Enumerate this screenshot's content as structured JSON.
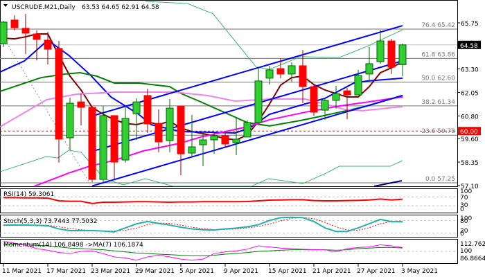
{
  "header": {
    "symbol": "USCRUDE.M21,Daily",
    "ohlc": "63.53 64.65 62.91 64.58"
  },
  "colors": {
    "bull": "#32CD32",
    "bull_edge": "#006400",
    "bear": "#FF0000",
    "bear_edge": "#8B0000",
    "channel": "#0000FF",
    "ma_fast": "#800000",
    "ma_blue": "#0000FF",
    "ma_green": "#008000",
    "ma_violet": "#EE82EE",
    "ma_magenta": "#FF00FF",
    "bands": "#3CB371"
  },
  "price_axis": {
    "ticks": [
      "65.75",
      "63.30",
      "62.05",
      "60.80",
      "59.60",
      "58.35",
      "57.10"
    ],
    "last_price": "64.58",
    "alert_price": "60.00"
  },
  "fib_levels": [
    {
      "label": "76.4 65.42",
      "price": 65.42
    },
    {
      "label": "61.8 63.86",
      "price": 63.86
    },
    {
      "label": "50.0 62.60",
      "price": 62.6
    },
    {
      "label": "38.2 61.34",
      "price": 61.34
    },
    {
      "label": "23.6 59.78",
      "price": 59.78
    },
    {
      "label": "0.0 57.25",
      "price": 57.25
    }
  ],
  "chart_data": {
    "type": "candlestick",
    "candles": [
      [
        64.65,
        65.86,
        64.46,
        65.79
      ],
      [
        65.9,
        66.15,
        65.35,
        65.49
      ],
      [
        65.46,
        66.23,
        64.09,
        65.2
      ],
      [
        65.16,
        65.35,
        63.76,
        64.87
      ],
      [
        64.83,
        65.27,
        63.54,
        64.35
      ],
      [
        64.39,
        64.79,
        58.32,
        59.57
      ],
      [
        59.64,
        61.78,
        58.98,
        61.48
      ],
      [
        61.55,
        62.0,
        60.3,
        61.26
      ],
      [
        61.26,
        61.33,
        57.29,
        57.43
      ],
      [
        57.43,
        61.33,
        57.29,
        60.82
      ],
      [
        60.82,
        60.82,
        57.47,
        58.35
      ],
      [
        58.46,
        61.3,
        58.32,
        60.67
      ],
      [
        60.93,
        61.74,
        59.53,
        61.55
      ],
      [
        61.89,
        62.25,
        59.9,
        60.38
      ],
      [
        60.41,
        61.15,
        58.87,
        59.42
      ],
      [
        59.49,
        61.7,
        58.87,
        61.22
      ],
      [
        61.33,
        61.33,
        57.65,
        58.79
      ],
      [
        58.83,
        60.86,
        58.57,
        59.16
      ],
      [
        59.27,
        59.97,
        58.13,
        59.53
      ],
      [
        59.53,
        59.97,
        58.79,
        59.75
      ],
      [
        59.75,
        59.97,
        59.13,
        59.31
      ],
      [
        59.38,
        60.75,
        58.72,
        59.57
      ],
      [
        59.68,
        60.56,
        59.68,
        60.45
      ],
      [
        60.45,
        63.36,
        60.45,
        62.66
      ],
      [
        62.81,
        63.47,
        62.47,
        63.25
      ],
      [
        63.32,
        63.87,
        62.81,
        63.03
      ],
      [
        63.03,
        63.65,
        62.59,
        63.47
      ],
      [
        63.47,
        64.31,
        61.48,
        62.36
      ],
      [
        62.36,
        62.47,
        60.82,
        61.0
      ],
      [
        61.11,
        61.78,
        60.6,
        61.63
      ],
      [
        61.63,
        62.4,
        61.19,
        61.99
      ],
      [
        62.14,
        62.29,
        60.63,
        61.92
      ],
      [
        61.92,
        63.25,
        61.92,
        62.95
      ],
      [
        63.03,
        64.46,
        62.59,
        63.58
      ],
      [
        63.69,
        65.38,
        63.58,
        64.79
      ],
      [
        64.79,
        64.9,
        63.03,
        63.39
      ],
      [
        63.53,
        64.65,
        62.91,
        64.58
      ]
    ],
    "x_labels": [
      {
        "i": 0,
        "label": "11 Mar 2021"
      },
      {
        "i": 4,
        "label": "17 Mar 2021"
      },
      {
        "i": 8,
        "label": "23 Mar 2021"
      },
      {
        "i": 12,
        "label": "29 Mar 2021"
      },
      {
        "i": 16,
        "label": "5 Apr 2021"
      },
      {
        "i": 20,
        "label": "9 Apr 2021"
      },
      {
        "i": 24,
        "label": "15 Apr 2021"
      },
      {
        "i": 28,
        "label": "21 Apr 2021"
      },
      {
        "i": 32,
        "label": "27 Apr 2021"
      },
      {
        "i": 36,
        "label": "3 May 2021"
      }
    ],
    "ylim": [
      57.1,
      65.75
    ],
    "channel": [
      {
        "from": [
          9,
          60.8
        ],
        "to": [
          37,
          65.6
        ]
      },
      {
        "from": [
          9,
          58.92
        ],
        "to": [
          37,
          63.73
        ]
      },
      {
        "from": [
          9,
          57.08
        ],
        "to": [
          37,
          61.89
        ]
      }
    ],
    "moving_averages": [
      {
        "name": "ma_fast",
        "points": [
          [
            1,
            64.94
          ],
          [
            2,
            64.9
          ],
          [
            3,
            65.01
          ],
          [
            4,
            65.16
          ],
          [
            5,
            65.16
          ],
          [
            6,
            64.02
          ],
          [
            7,
            62.92
          ],
          [
            8,
            62.18
          ],
          [
            9,
            61.26
          ],
          [
            10,
            60.89
          ],
          [
            11,
            60.6
          ],
          [
            12,
            60.41
          ],
          [
            13,
            60.34
          ],
          [
            14,
            60.49
          ],
          [
            15,
            60.34
          ],
          [
            16,
            60.52
          ],
          [
            17,
            60.16
          ],
          [
            18,
            59.97
          ],
          [
            19,
            59.86
          ],
          [
            20,
            59.75
          ],
          [
            21,
            59.6
          ],
          [
            22,
            59.53
          ],
          [
            23,
            59.79
          ],
          [
            24,
            60.52
          ],
          [
            25,
            61.44
          ],
          [
            26,
            62.44
          ],
          [
            27,
            62.84
          ],
          [
            28,
            62.92
          ],
          [
            29,
            62.47
          ],
          [
            30,
            62.18
          ],
          [
            31,
            61.99
          ],
          [
            32,
            61.81
          ],
          [
            33,
            61.81
          ],
          [
            34,
            62.36
          ],
          [
            35,
            63.1
          ],
          [
            36,
            63.36
          ],
          [
            37,
            63.69
          ]
        ]
      },
      {
        "name": "ma_blue",
        "points": [
          [
            0.7,
            63.14
          ],
          [
            2.9,
            63.73
          ],
          [
            5,
            64.83
          ],
          [
            6.9,
            64.02
          ],
          [
            8.8,
            63.0
          ],
          [
            10.7,
            61.81
          ],
          [
            13.2,
            60.89
          ],
          [
            14.3,
            60.34
          ],
          [
            17,
            59.97
          ],
          [
            19.4,
            59.94
          ],
          [
            21.9,
            59.9
          ],
          [
            23.2,
            60.16
          ],
          [
            25,
            60.89
          ],
          [
            27.8,
            61.37
          ],
          [
            30,
            61.74
          ],
          [
            32.6,
            62.55
          ],
          [
            33.8,
            62.66
          ],
          [
            37,
            62.81
          ]
        ]
      },
      {
        "name": "ma_green",
        "points": [
          [
            0.7,
            62.11
          ],
          [
            4.4,
            62.84
          ],
          [
            6.6,
            63.03
          ],
          [
            7.9,
            63.1
          ],
          [
            9.4,
            62.92
          ],
          [
            11,
            62.55
          ],
          [
            13.2,
            62.55
          ],
          [
            16,
            62.36
          ],
          [
            17,
            62.0
          ],
          [
            18.8,
            61.55
          ],
          [
            23,
            60.45
          ],
          [
            25,
            60.27
          ],
          [
            27.8,
            60.56
          ],
          [
            29.6,
            60.78
          ],
          [
            31.3,
            61.0
          ],
          [
            33.8,
            61.33
          ],
          [
            37,
            61.89
          ]
        ]
      },
      {
        "name": "ma_violet",
        "points": [
          [
            0.7,
            60.23
          ],
          [
            4.9,
            61.67
          ],
          [
            7.6,
            61.96
          ],
          [
            11.1,
            62.07
          ],
          [
            16.3,
            62.07
          ],
          [
            19.4,
            61.89
          ],
          [
            21.9,
            61.59
          ],
          [
            25,
            61.7
          ],
          [
            28.2,
            61.7
          ],
          [
            31.8,
            61.15
          ],
          [
            33.4,
            61.08
          ],
          [
            37,
            61.3
          ]
        ]
      },
      {
        "name": "ma_magenta",
        "points": [
          [
            3.8,
            57.07
          ],
          [
            6.9,
            57.77
          ],
          [
            8.6,
            58.1
          ],
          [
            11.1,
            58.46
          ],
          [
            13.6,
            58.94
          ],
          [
            16.9,
            59.35
          ],
          [
            18.8,
            59.68
          ],
          [
            23,
            60.23
          ],
          [
            25,
            60.6
          ],
          [
            28.2,
            61.0
          ],
          [
            31.3,
            61.33
          ],
          [
            37,
            61.81
          ]
        ]
      },
      {
        "name": "bands",
        "points": [
          [
            13.8,
            66.89
          ],
          [
            17.6,
            66.78
          ],
          [
            19.9,
            66.23
          ],
          [
            23.8,
            63.4
          ],
          [
            25,
            63.28
          ],
          [
            27.8,
            63.95
          ],
          [
            31.3,
            63.91
          ],
          [
            33.8,
            64.5
          ],
          [
            37,
            65.38
          ]
        ]
      },
      {
        "name": "bands",
        "points": [
          [
            0.7,
            57.84
          ],
          [
            4.9,
            58.65
          ],
          [
            5.9,
            58.57
          ],
          [
            6.9,
            58.98
          ],
          [
            8,
            58.87
          ],
          [
            10.1,
            57.47
          ],
          [
            11.8,
            57.14
          ],
          [
            13.8,
            57.47
          ],
          [
            16.3,
            57.07
          ],
          [
            23.4,
            57.07
          ],
          [
            24.9,
            57.47
          ],
          [
            28,
            57.21
          ],
          [
            30.1,
            57.76
          ],
          [
            31.3,
            58.13
          ],
          [
            35.9,
            58.13
          ],
          [
            37,
            58.43
          ]
        ]
      }
    ],
    "rsi": {
      "label": "RSI(14) 59.3061",
      "levels_labels": [
        "100",
        "70",
        "30",
        "0"
      ],
      "values": [
        66,
        66,
        65,
        65,
        64,
        52,
        50,
        50,
        40,
        46,
        46,
        47,
        48,
        48,
        47,
        46,
        47,
        47,
        48,
        48,
        48,
        48,
        49,
        52,
        55,
        56,
        57,
        57,
        53,
        52,
        52,
        53,
        54,
        56,
        60,
        56,
        59.3
      ]
    },
    "stoch": {
      "label": "Stoch(5,3,3) 73.7443 77.5032",
      "levels_labels": [
        "100",
        "80",
        "20",
        "0"
      ],
      "main": [
        58,
        58,
        58,
        57,
        55,
        40,
        32,
        32,
        32,
        30,
        26,
        45,
        64,
        75,
        66,
        58,
        48,
        40,
        36,
        35,
        40,
        44,
        50,
        60,
        80,
        93,
        95,
        93,
        75,
        45,
        28,
        28,
        45,
        65,
        85,
        74,
        73.74
      ],
      "signal": [
        58,
        58,
        58,
        58,
        57,
        50,
        42,
        36,
        33,
        31,
        30,
        33,
        44,
        60,
        68,
        66,
        58,
        48,
        41,
        37,
        37,
        40,
        45,
        51,
        63,
        78,
        90,
        94,
        88,
        71,
        50,
        35,
        34,
        46,
        64,
        75,
        77.5
      ]
    },
    "momentum": {
      "label": "Momentum(14) 106.8498  ->MA(7) 106.1874",
      "axis_labels": [
        "112.7625",
        "100",
        "86.8664"
      ],
      "values": [
        118,
        115,
        111,
        105,
        102,
        98,
        96,
        100,
        101,
        96,
        90,
        88,
        84,
        90,
        93,
        90,
        86,
        84,
        86,
        96,
        99,
        101,
        104,
        110,
        108,
        106,
        105,
        104,
        103,
        103,
        99,
        105,
        107,
        108,
        112,
        110,
        106.85
      ],
      "ma": [
        113,
        113,
        112,
        111,
        110,
        108,
        106,
        105,
        104,
        103,
        101,
        99,
        97,
        96,
        95,
        94,
        93,
        92,
        92,
        93,
        95,
        96,
        98,
        100,
        101,
        102,
        103,
        103,
        103,
        103,
        102,
        103,
        105,
        106,
        107,
        107,
        106.19
      ]
    }
  }
}
